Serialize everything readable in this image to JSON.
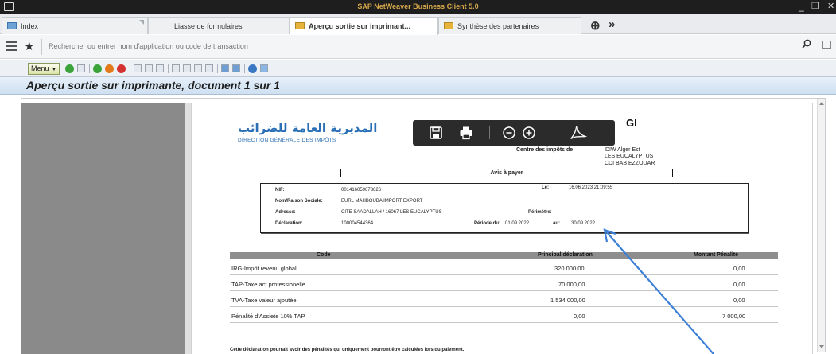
{
  "window": {
    "title": "SAP NetWeaver Business Client 5.0",
    "minimize_glyph": "_",
    "restore_glyph": "❐",
    "close_glyph": "✕"
  },
  "tabs": [
    {
      "label": "Index",
      "icon": "tree-icon",
      "active": false
    },
    {
      "label": "Liasse de formulaires",
      "icon": "",
      "active": false
    },
    {
      "label": "Aperçu sortie sur imprimant...",
      "icon": "document-icon",
      "active": true
    },
    {
      "label": "Synthèse des partenaires",
      "icon": "document-icon",
      "active": false
    }
  ],
  "tab_extra": {
    "add_glyph": "⊕",
    "more_glyph": "»"
  },
  "command_bar": {
    "search_placeholder": "Rechercher ou entrer nom d'application ou code de transaction"
  },
  "app_toolbar": {
    "menu_label": "Menu"
  },
  "page": {
    "title": "Aperçu sortie sur imprimante, document 1 sur 1"
  },
  "document": {
    "logo_arabic": "المديرية العامة للضرائب",
    "logo_french": "DIRECTION GÉNÉRALE DES IMPÔTS",
    "header_fragment": "GI",
    "centre_label": "Centre des impôts de",
    "centre_lines": [
      "DIW Alger Est",
      "LES EUCALYPTUS",
      "CDI BAB EZZOUAR"
    ],
    "avis_title": "Avis à payer",
    "info": {
      "nif_label": "NIF:",
      "nif_value": "001416059673626",
      "le_label": "Le:",
      "le_value": "16.06.2023 21:09:55",
      "nom_label": "Nom/Raison Sociale:",
      "nom_value": "EURL MAHBOUBA IMPORT EXPORT",
      "adresse_label": "Adresse:",
      "adresse_value": "CITE SAADALLAH / 16067 LES EUCALYPTUS",
      "perimetre_label": "Périmètre:",
      "declaration_label": "Déclaration:",
      "declaration_value": "100004544364",
      "periode_label": "Période du:",
      "periode_du": "01.09.2022",
      "au_label": "au:",
      "periode_au": "30.09.2022"
    },
    "table": {
      "headers": [
        "Code",
        "Principal déclaration",
        "Montant Pénalité"
      ],
      "rows": [
        [
          "IRG-Impôt revenu global",
          "320 000,00",
          "0,00"
        ],
        [
          "TAP-Taxe act professionelle",
          "70 000,00",
          "0,00"
        ],
        [
          "TVA-Taxe valeur ajoutée",
          "1 534 000,00",
          "0,00"
        ],
        [
          "Pénalité d'Assiete 10% TAP",
          "0,00",
          "7 000,00"
        ]
      ]
    },
    "footnote": "Cette déclaration pourrait avoir des pénalités qui uniquement pourront être calculées lors du paiement."
  },
  "pdf_toolbar": {
    "icons": [
      "save-icon",
      "print-icon",
      "zoom-out-icon",
      "zoom-in-icon",
      "acrobat-icon"
    ]
  },
  "colors": {
    "title_text": "#d7a84a",
    "logo_blue": "#2a6fb5",
    "annotation_arrow": "#3b7fd6",
    "table_header": "#8e8e8e"
  }
}
